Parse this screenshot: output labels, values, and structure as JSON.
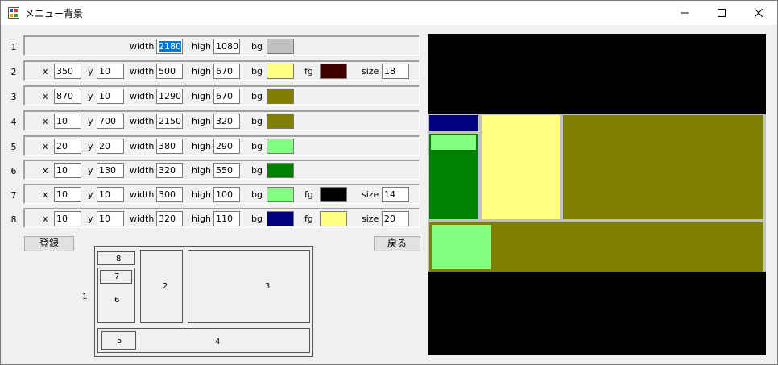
{
  "window": {
    "title": "メニュー背景",
    "controls": [
      "minimize",
      "maximize",
      "close"
    ]
  },
  "labels": {
    "x": "x",
    "y": "y",
    "width": "width",
    "high": "high",
    "bg": "bg",
    "fg": "fg",
    "size": "size"
  },
  "rows": [
    {
      "num": "1",
      "width": "2180",
      "high": "1080",
      "bg": "#c0c0c0",
      "width_selected": true
    },
    {
      "num": "2",
      "x": "350",
      "y": "10",
      "width": "500",
      "high": "670",
      "bg": "#ffff80",
      "fg": "#400000",
      "size": "18"
    },
    {
      "num": "3",
      "x": "870",
      "y": "10",
      "width": "1290",
      "high": "670",
      "bg": "#808000"
    },
    {
      "num": "4",
      "x": "10",
      "y": "700",
      "width": "2150",
      "high": "320",
      "bg": "#808000"
    },
    {
      "num": "5",
      "x": "20",
      "y": "20",
      "width": "380",
      "high": "290",
      "bg": "#80ff80"
    },
    {
      "num": "6",
      "x": "10",
      "y": "130",
      "width": "320",
      "high": "550",
      "bg": "#008000"
    },
    {
      "num": "7",
      "x": "10",
      "y": "10",
      "width": "300",
      "high": "100",
      "bg": "#80ff80",
      "fg": "#000000",
      "size": "14"
    },
    {
      "num": "8",
      "x": "10",
      "y": "10",
      "width": "320",
      "high": "110",
      "bg": "#000080",
      "fg": "#ffff80",
      "size": "20"
    }
  ],
  "buttons": {
    "register": "登録",
    "back": "戻る"
  },
  "diagram": {
    "l1": "1",
    "l2": "2",
    "l3": "3",
    "l4": "4",
    "l5": "5",
    "l6": "6",
    "l7": "7",
    "l8": "8"
  },
  "preview_colors": {
    "background": "#000000",
    "frame": "#c0c0c0",
    "yellow": "#ffff80",
    "olive": "#808000",
    "light_green": "#80ff80",
    "green": "#008000",
    "navy": "#000080"
  }
}
